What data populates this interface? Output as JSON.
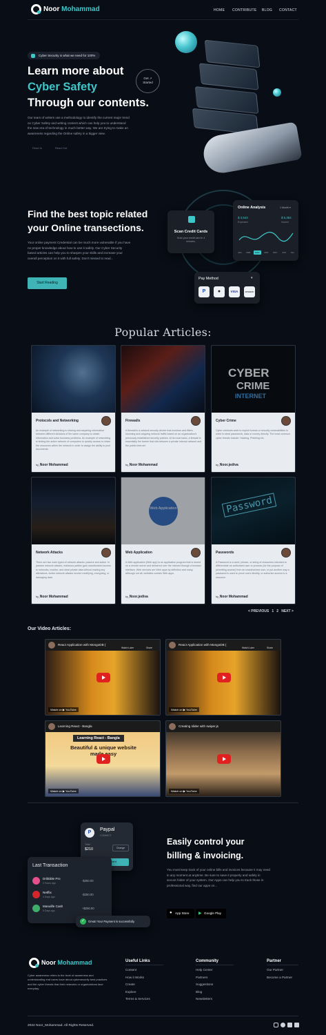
{
  "brand": {
    "first": "Noor",
    "last": "Mohammad"
  },
  "nav": {
    "items": [
      "HOME",
      "CONTRIBUTE",
      "BLOG",
      "CONTACT"
    ]
  },
  "hero": {
    "pill": "Cyber Security is what we need for 100%",
    "title_1": "Learn more about",
    "title_accent": "Cyber Safety",
    "title_3": "Through our contents.",
    "description": "Our team of writers use a methodology to identify the current major trend on Cyber Safety and writing content which can help you to understand the new era of technology in much better way. We are trying to make an awareness regarding the Online safety in a bigger view.",
    "ghost_1": "Read In",
    "ghost_2": "Read Out",
    "get_started_1": "Get",
    "get_started_arrow": "↗",
    "get_started_2": "Started"
  },
  "topic": {
    "title_1": "Find the best topic related",
    "title_2": "your Online transections.",
    "description": "Your online payment Credential can be much more vulnerable if you have no proper knowledge about how to use it safely. Our Cyber Security based articles can help you to sharpen your skills and increase your overall perception on it with full safety. Don't missed to read...",
    "button": "Start Reading"
  },
  "scan_card": {
    "title": "Scan Credit Cards",
    "sub": "Scan your credit card in 4 minutes."
  },
  "analysis": {
    "title": "Online Analysis",
    "period": "1 Month ▾",
    "left_value": "$ 3,543",
    "left_label": "Expenses",
    "right_value": "$ 5,384",
    "right_label": "Income",
    "months": [
      "JAN",
      "FEB",
      "MAR",
      "APR",
      "MAY",
      "JUN",
      "JUL"
    ],
    "active_month": "MAR"
  },
  "pay_method": {
    "title": "Pay Method",
    "options": [
      "P",
      "",
      "VISA",
      "amazon"
    ]
  },
  "articles": {
    "heading": "Popular Articles:",
    "items": [
      {
        "title": "Protocols and Networking",
        "desc": "An example of networking is sharing and acquiring information between different divisions of the same company to obtain information and solve business problems. An example of networking is finding the active network of computers to quickly access to share the resources within the network in order to assign the ability to pool documents.",
        "author": "Noor Mohammad"
      },
      {
        "title": "Firewalls",
        "desc": "A firewall is a network security device that monitors and filters incoming and outgoing network traffic based on an organization's previously established security policies. At its most basic, a firewall is essentially the barrier that sits between a private internal network and the public Internet.",
        "author": "Noor Mohammad"
      },
      {
        "title": "Cyber Crime",
        "desc": "Cyber criminals seek to exploit human or security vulnerabilities in order to steal passwords, data or money directly. The most common cyber threats include: Hacking, Phishing etc.",
        "author": "Noor.jediva"
      },
      {
        "title": "Network Attacks",
        "desc": "There are two main types of network attacks: passive and active. In passive network attacks, malicious parties gain unauthorized access to networks, monitor, and steal private data without making any alterations. Active network attacks involve modifying, encrypting, or damaging data.",
        "author": "Noor Mohammad"
      },
      {
        "title": "Web Application",
        "desc": "A Web application (Web app) is an application program that is stored on a remote server and delivered over the Internet through a browser interface. Web services are Web apps by definition and many, although not all, websites contain Web apps.",
        "author": "Noor.jediva"
      },
      {
        "title": "Passwords",
        "desc": "A Password is a word, phrase, or string of characters intended to differentiate an authorized user or process (for the purpose of permitting access) from an unauthorized user, or put another way a password is used to prove one's identity, or authorize access to a resource.",
        "author": "Noor Mohammad"
      }
    ],
    "by": "by_",
    "image_words": {
      "cyber": "CYBER",
      "crime": "CRIME",
      "internet": "INTERNET",
      "web": "Web Application",
      "password": "Password"
    }
  },
  "pager": {
    "prev": "< PREVIOUS",
    "p1": "1",
    "p2": "2",
    "next": "NEXT >"
  },
  "videos": {
    "heading": "Our Video Articles:",
    "items": [
      {
        "title": "React Application with MongoDB ("
      },
      {
        "title": "React Application with MongoDB ("
      },
      {
        "title": "Learning React - Bangla",
        "banner": "Learning React - Bangla",
        "tagline": "Beautiful & unique website made easy"
      },
      {
        "title": "Creating slider with swiper.js"
      }
    ],
    "watch_later": "Watch Later",
    "share": "Share",
    "watch_on": "Watch on ▶ YouTube"
  },
  "billing": {
    "paypal_title": "Paypal",
    "paypal_sub": "CONNECT",
    "total_label": "Total",
    "total_value": "$210",
    "change_btn": "Change",
    "make_payment": "Make Payment",
    "last_tx_title": "Last Transaction",
    "transactions": [
      {
        "name": "Dribbble Pro",
        "time": "2 Hours ago",
        "amount": "-$250.00"
      },
      {
        "name": "Netflix",
        "time": "4 Days ago",
        "amount": "-$250.00"
      },
      {
        "name": "Manulife Cash",
        "time": "5 Days ago",
        "amount": "+$250.00"
      }
    ],
    "toast": "Great! Your Payment is successfully.",
    "title_1": "Easily control your",
    "title_2": "billing & invoicing.",
    "description": "You must keep track of your online bills and invoices because it may need in any moment at anytime. Be sure to save it properly and safely in secure folder of your system. Our Apps can help you to track those in professional way, find our apps on...",
    "app_store": "App Store",
    "google_play": "Google Play"
  },
  "footer": {
    "about": "Cyber awareness refers to the level of awareness and understanding end users have about cybersecurity best practices and the cyber threats that their networks or organizations face everyday.",
    "useful_title": "Useful Links",
    "useful": [
      "Content",
      "How it Works",
      "Create",
      "Explore",
      "Terms & Services"
    ],
    "community_title": "Community",
    "community": [
      "Help Center",
      "Partners",
      "Suggestions",
      "Blog",
      "Newsletters"
    ],
    "partner_title": "Partner",
    "partner": [
      "Our Partner",
      "Become a Partner"
    ],
    "copyright": "2022 Noor_Mohammad. All Rights Reserved."
  },
  "colors": {
    "accent": "#3ec7c9",
    "background": "#080d16"
  }
}
